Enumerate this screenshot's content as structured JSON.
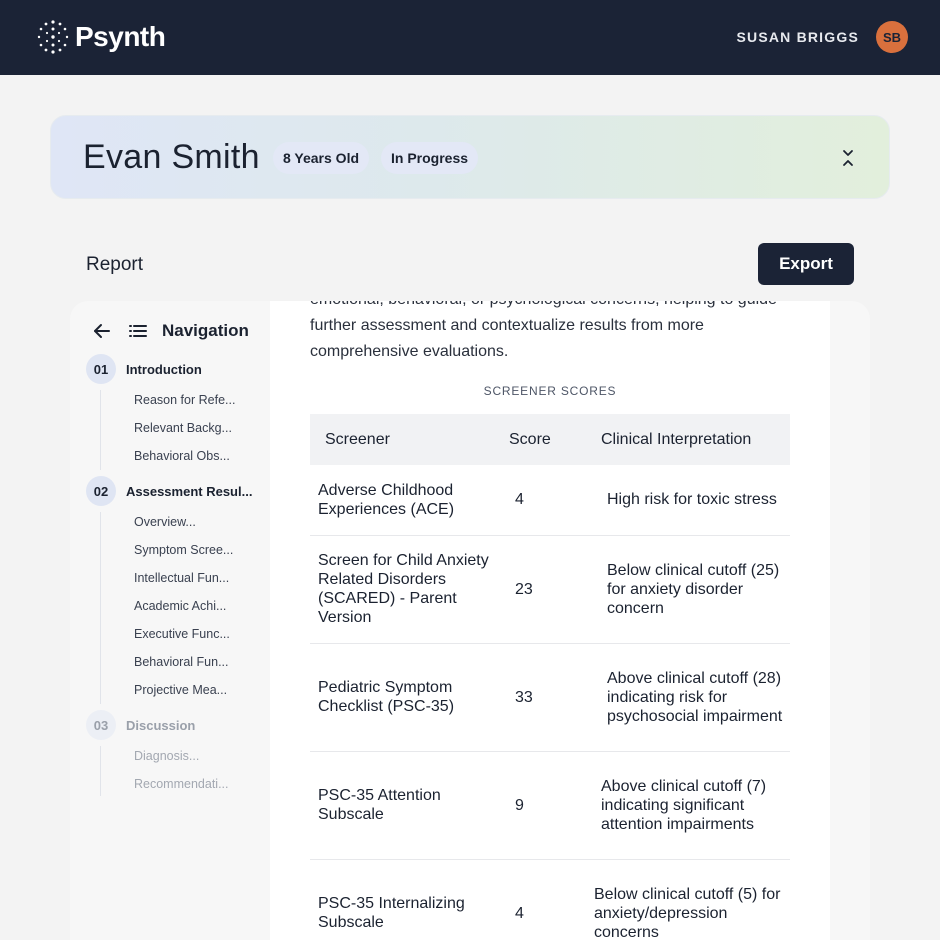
{
  "app": {
    "brand": "Psynth"
  },
  "user": {
    "name": "SUSAN BRIGGS",
    "initials": "SB"
  },
  "patient": {
    "name": "Evan Smith",
    "age": "8 Years Old",
    "status": "In Progress"
  },
  "report": {
    "title": "Report",
    "export_label": "Export"
  },
  "nav": {
    "title": "Navigation",
    "sections": [
      {
        "num": "01",
        "label": "Introduction",
        "items": [
          "Reason for Refe...",
          "Relevant Backg...",
          "Behavioral Obs..."
        ]
      },
      {
        "num": "02",
        "label": "Assessment Resul...",
        "items": [
          "Overview...",
          "Symptom Scree...",
          "Intellectual Fun...",
          "Academic Achi...",
          "Executive Func...",
          "Behavioral Fun...",
          "Projective Mea..."
        ]
      },
      {
        "num": "03",
        "label": "Discussion",
        "items": [
          "Diagnosis...",
          "Recommendati..."
        ]
      }
    ]
  },
  "content": {
    "intro_text": "emotional, behavioral, or psychological concerns, helping to guide further assessment and contextualize results from more comprehensive evaluations.",
    "table_caption": "SCREENER SCORES",
    "columns": [
      "Screener",
      "Score",
      "Clinical Interpretation"
    ],
    "rows": [
      {
        "screener": "Adverse Childhood Experiences (ACE)",
        "score": "4",
        "interpretation": "High risk for toxic stress"
      },
      {
        "screener": "Screen for Child Anxiety Related Disorders (SCARED) - Parent Version",
        "score": "23",
        "interpretation": "Below clinical cutoff (25) for anxiety disorder concern"
      },
      {
        "screener": "Pediatric Symptom Checklist (PSC-35)",
        "score": "33",
        "interpretation": "Above clinical cutoff (28) indicating risk for psychosocial impairment"
      },
      {
        "screener": " PSC-35 Attention Subscale",
        "score": "9",
        "interpretation": "Above clinical cutoff (7) indicating significant attention impairments"
      },
      {
        "screener": "PSC-35 Internalizing Subscale",
        "score": "4",
        "interpretation": "Below clinical cutoff (5) for anxiety/depression concerns"
      }
    ]
  },
  "colors": {
    "topbar": "#1b2336",
    "avatar": "#d9703d",
    "accent_pill": "#e3e8f6"
  }
}
